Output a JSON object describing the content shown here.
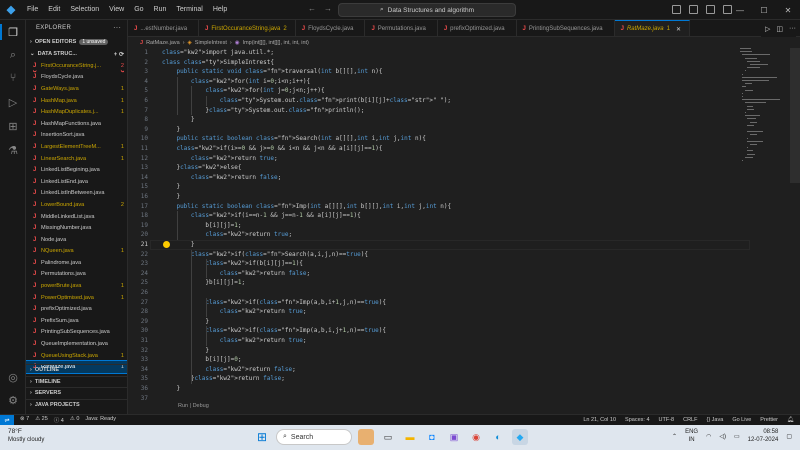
{
  "menu": [
    "File",
    "Edit",
    "Selection",
    "View",
    "Go",
    "Run",
    "Terminal",
    "Help"
  ],
  "search": {
    "label": "Data Structures and algorithm"
  },
  "sidebar": {
    "title": "EXPLORER",
    "open_editors": "OPEN EDITORS",
    "unsaved": "1 unsaved",
    "folder": "DATA STRUC...",
    "files": [
      {
        "name": "FirstOccuranceString.j...",
        "count": "2",
        "state": "err"
      },
      {
        "name": "FloydsCycle.java",
        "count": "",
        "state": ""
      },
      {
        "name": "GateWays.java",
        "count": "1",
        "state": "warn"
      },
      {
        "name": "HashMap.java",
        "count": "1",
        "state": "warn"
      },
      {
        "name": "HashMapDuplicates.j...",
        "count": "1",
        "state": "warn"
      },
      {
        "name": "HashMapFunctions.java",
        "count": "",
        "state": ""
      },
      {
        "name": "InsertionSort.java",
        "count": "",
        "state": ""
      },
      {
        "name": "LargestElementTreeM...",
        "count": "1",
        "state": "warn"
      },
      {
        "name": "LinearSearch.java",
        "count": "1",
        "state": "warn"
      },
      {
        "name": "LinkedListBegining.java",
        "count": "",
        "state": ""
      },
      {
        "name": "LinkedListEnd.java",
        "count": "",
        "state": ""
      },
      {
        "name": "LinkedListInBetween.java",
        "count": "",
        "state": ""
      },
      {
        "name": "LowerBound.java",
        "count": "2",
        "state": "warn"
      },
      {
        "name": "MiddleLinkedList.java",
        "count": "",
        "state": ""
      },
      {
        "name": "MissingNumber.java",
        "count": "",
        "state": ""
      },
      {
        "name": "Node.java",
        "count": "",
        "state": ""
      },
      {
        "name": "NQueen.java",
        "count": "1",
        "state": "warn"
      },
      {
        "name": "Palindrome.java",
        "count": "",
        "state": ""
      },
      {
        "name": "Permutations.java",
        "count": "",
        "state": ""
      },
      {
        "name": "powerBrute.java",
        "count": "1",
        "state": "warn"
      },
      {
        "name": "PowerOptimised.java",
        "count": "1",
        "state": "warn"
      },
      {
        "name": "prefixOptimized.java",
        "count": "",
        "state": ""
      },
      {
        "name": "PrefixSum.java",
        "count": "",
        "state": ""
      },
      {
        "name": "PrintingSubSequences.java",
        "count": "",
        "state": ""
      },
      {
        "name": "QueueImplementation.java",
        "count": "",
        "state": ""
      },
      {
        "name": "QueueUsingStack.java",
        "count": "1",
        "state": "warn"
      },
      {
        "name": "RatMaze.java",
        "count": "1",
        "state": "sel"
      }
    ],
    "bottom": [
      "OUTLINE",
      "TIMELINE",
      "SERVERS",
      "JAVA PROJECTS"
    ]
  },
  "tabs": [
    {
      "name": "...estNumber.java",
      "count": "",
      "state": ""
    },
    {
      "name": "FirstOccuranceString.java",
      "count": "2",
      "state": "warn"
    },
    {
      "name": "FloydsCycle.java",
      "count": "",
      "state": ""
    },
    {
      "name": "Permutations.java",
      "count": "",
      "state": ""
    },
    {
      "name": "prefixOptimized.java",
      "count": "",
      "state": ""
    },
    {
      "name": "PrintingSubSequences.java",
      "count": "",
      "state": ""
    },
    {
      "name": "RatMaze.java",
      "count": "1",
      "state": "active"
    }
  ],
  "breadcrumb": {
    "file": "RatMaze.java",
    "cls": "SimpleIntrest",
    "method": "Imp(int[][], int[][], int, int, int)"
  },
  "editor": {
    "current_line": 21,
    "codelens": "Run | Debug",
    "lines": [
      "import java.util.*;",
      "class SimpleIntrest{",
      "    public static void traversal(int b[][],int n){",
      "        for(int i=0;i<n;i++){",
      "            for(int j=0;j<n;j++){",
      "                System.out.print(b[i][j]+\" \");",
      "            }System.out.println();",
      "        }",
      "    }",
      "    public static boolean Search(int a[][],int i,int j,int n){",
      "    if(i>=0 && j>=0 && i<n && j<n && a[i][j]==1){",
      "        return true;",
      "    }else{",
      "        return false;",
      "    }",
      "    }",
      "    public static boolean Imp(int a[][],int b[][],int i,int j,int n){",
      "        if(i==n-1 && j==n-1 && a[i][j]==1){",
      "            b[i][j]=1;",
      "            return true;",
      "        }",
      "        if(Search(a,i,j,n)==true){",
      "            if(b[i][j]==1){",
      "                return false;",
      "            }b[i][j]=1;",
      "",
      "            if(Imp(a,b,i+1,j,n)==true){",
      "                return true;",
      "            }",
      "            if(Imp(a,b,i,j+1,n)==true){",
      "                return true;",
      "            }",
      "            b[i][j]=0;",
      "            return false;",
      "        }return false;",
      "    }",
      ""
    ]
  },
  "status": {
    "left": [
      "⊗ 7",
      "⚠ 25",
      "ⓘ 4",
      "⚠ 0",
      "Java: Ready"
    ],
    "right": [
      "Ln 21, Col 10",
      "Spaces: 4",
      "UTF-8",
      "CRLF",
      "{} Java",
      "Go Live",
      "Prettier"
    ]
  },
  "taskbar": {
    "temp": "78°F",
    "weather": "Mostly cloudy",
    "search": "Search",
    "lang1": "ENG",
    "lang2": "IN",
    "time": "08:58",
    "date": "12-07-2024"
  }
}
